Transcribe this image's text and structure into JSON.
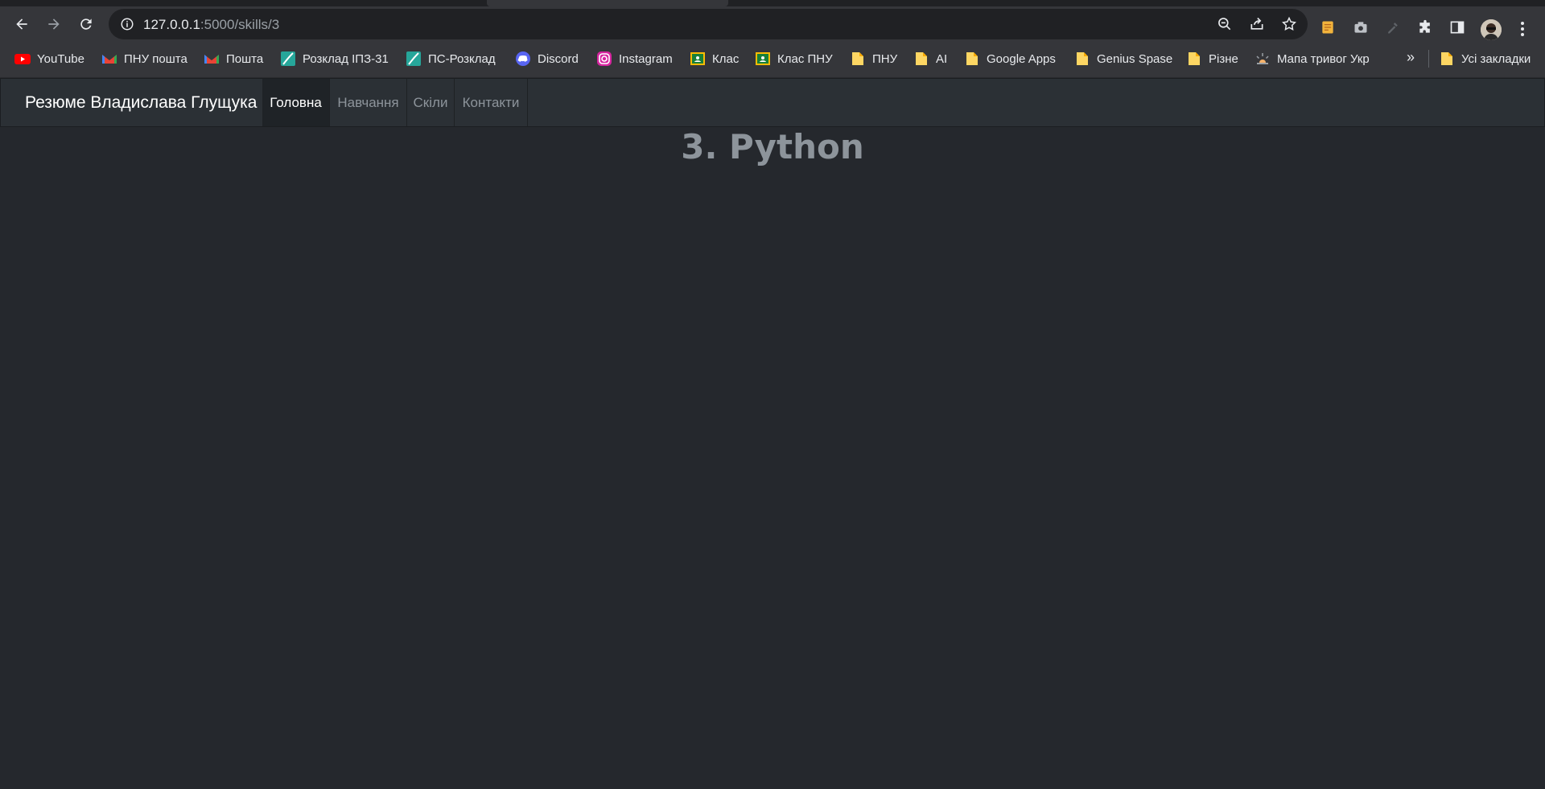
{
  "browser": {
    "url_host": "127.0.0.1",
    "url_path": ":5000/skills/3"
  },
  "bookmarks": {
    "items": [
      {
        "label": "YouTube",
        "icon": "youtube-icon"
      },
      {
        "label": "ПНУ пошта",
        "icon": "gmail-icon"
      },
      {
        "label": "Пошта",
        "icon": "gmail-icon"
      },
      {
        "label": "Розклад ІПЗ-31",
        "icon": "schedule-icon"
      },
      {
        "label": "ПС-Розклад",
        "icon": "schedule-icon"
      },
      {
        "label": "Discord",
        "icon": "discord-icon"
      },
      {
        "label": "Instagram",
        "icon": "instagram-icon"
      },
      {
        "label": "Клас",
        "icon": "classroom-icon"
      },
      {
        "label": "Клас ПНУ",
        "icon": "classroom-icon"
      },
      {
        "label": "ПНУ",
        "icon": "folder-icon"
      },
      {
        "label": "AI",
        "icon": "folder-icon"
      },
      {
        "label": "Google Apps",
        "icon": "folder-icon"
      },
      {
        "label": "Genius Spase",
        "icon": "folder-icon"
      },
      {
        "label": "Різне",
        "icon": "folder-icon"
      },
      {
        "label": "Мапа тривог Укр",
        "icon": "alert-map-icon"
      }
    ],
    "more_label": "»",
    "all_bookmarks_label": "Усі закладки"
  },
  "navbar": {
    "brand": "Резюме Владислава Глущука",
    "links": [
      {
        "label": "Головна",
        "active": true
      },
      {
        "label": "Навчання",
        "active": false
      },
      {
        "label": "Скіли",
        "active": false
      },
      {
        "label": "Контакти",
        "active": false
      }
    ]
  },
  "main": {
    "heading": "3. Python"
  },
  "colors": {
    "page_bg": "#25282d",
    "navbar_bg": "#2b3035",
    "muted_text": "#8d949b",
    "chrome_bg": "#35363a"
  }
}
